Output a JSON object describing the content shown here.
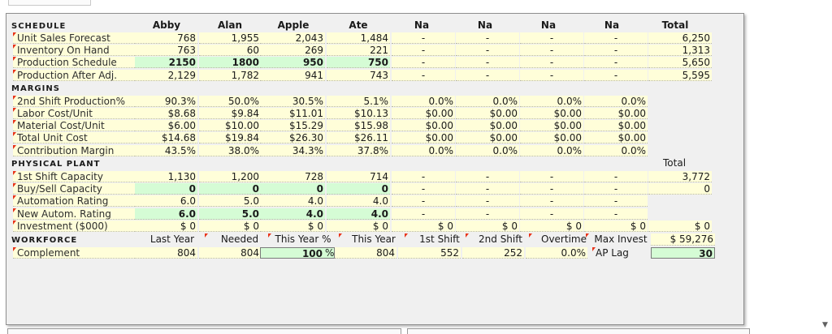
{
  "columns": [
    "Abby",
    "Alan",
    "Apple",
    "Ate",
    "Na",
    "Na",
    "Na",
    "Na",
    "Total"
  ],
  "schedule": {
    "title": "SCHEDULE",
    "rows": [
      {
        "label": "Unit Sales Forecast",
        "values": [
          "768",
          "1,955",
          "2,043",
          "1,484",
          "-",
          "-",
          "-",
          "-",
          "6,250"
        ]
      },
      {
        "label": "Inventory On Hand",
        "values": [
          "763",
          "60",
          "269",
          "221",
          "-",
          "-",
          "-",
          "-",
          "1,313"
        ]
      },
      {
        "label": "Production Schedule",
        "values": [
          "2150",
          "1800",
          "950",
          "750",
          "-",
          "-",
          "-",
          "-",
          "5,650"
        ]
      },
      {
        "label": "Production After Adj.",
        "values": [
          "2,129",
          "1,782",
          "941",
          "743",
          "-",
          "-",
          "-",
          "-",
          "5,595"
        ]
      }
    ]
  },
  "margins": {
    "title": "MARGINS",
    "rows": [
      {
        "label": "2nd Shift Production%",
        "values": [
          "90.3%",
          "50.0%",
          "30.5%",
          "5.1%",
          "0.0%",
          "0.0%",
          "0.0%",
          "0.0%"
        ]
      },
      {
        "label": "Labor Cost/Unit",
        "values": [
          "$8.68",
          "$9.84",
          "$11.01",
          "$10.13",
          "$0.00",
          "$0.00",
          "$0.00",
          "$0.00"
        ]
      },
      {
        "label": "Material Cost/Unit",
        "values": [
          "$6.00",
          "$10.00",
          "$15.29",
          "$15.98",
          "$0.00",
          "$0.00",
          "$0.00",
          "$0.00"
        ]
      },
      {
        "label": "Total Unit Cost",
        "values": [
          "$14.68",
          "$19.84",
          "$26.30",
          "$26.11",
          "$0.00",
          "$0.00",
          "$0.00",
          "$0.00"
        ]
      },
      {
        "label": "Contribution Margin",
        "values": [
          "43.5%",
          "38.0%",
          "34.3%",
          "37.8%",
          "0.0%",
          "0.0%",
          "0.0%",
          "0.0%"
        ]
      }
    ]
  },
  "plant": {
    "title": "PHYSICAL PLANT",
    "total_label": "Total",
    "rows": [
      {
        "label": "1st Shift Capacity",
        "values": [
          "1,130",
          "1,200",
          "728",
          "714",
          "-",
          "-",
          "-",
          "-",
          "3,772"
        ]
      },
      {
        "label": "Buy/Sell Capacity",
        "values": [
          "0",
          "0",
          "0",
          "0",
          "-",
          "-",
          "-",
          "-",
          "0"
        ]
      },
      {
        "label": "Automation Rating",
        "values": [
          "6.0",
          "5.0",
          "4.0",
          "4.0",
          "-",
          "-",
          "-",
          "-"
        ]
      },
      {
        "label": "New Autom. Rating",
        "values": [
          "6.0",
          "5.0",
          "4.0",
          "4.0",
          "-",
          "-",
          "-",
          "-"
        ]
      },
      {
        "label": "Investment ($000)",
        "values": [
          "$ 0",
          "$ 0",
          "$ 0",
          "$ 0",
          "$ 0",
          "$ 0",
          "$ 0",
          "$ 0",
          "$ 0"
        ]
      }
    ]
  },
  "workforce": {
    "title": "WORKFORCE",
    "headers": [
      "Last Year",
      "Needed",
      "This Year %",
      "This Year",
      "1st Shift",
      "2nd Shift",
      "Overtime",
      "Max Invest",
      "$ 59,276"
    ],
    "label": "Complement",
    "values": [
      "804",
      "804",
      "100",
      "804",
      "552",
      "252",
      "0.0%"
    ],
    "percent_sign": "%",
    "ap_lag_label": "AP Lag",
    "ap_lag_value": "30"
  }
}
